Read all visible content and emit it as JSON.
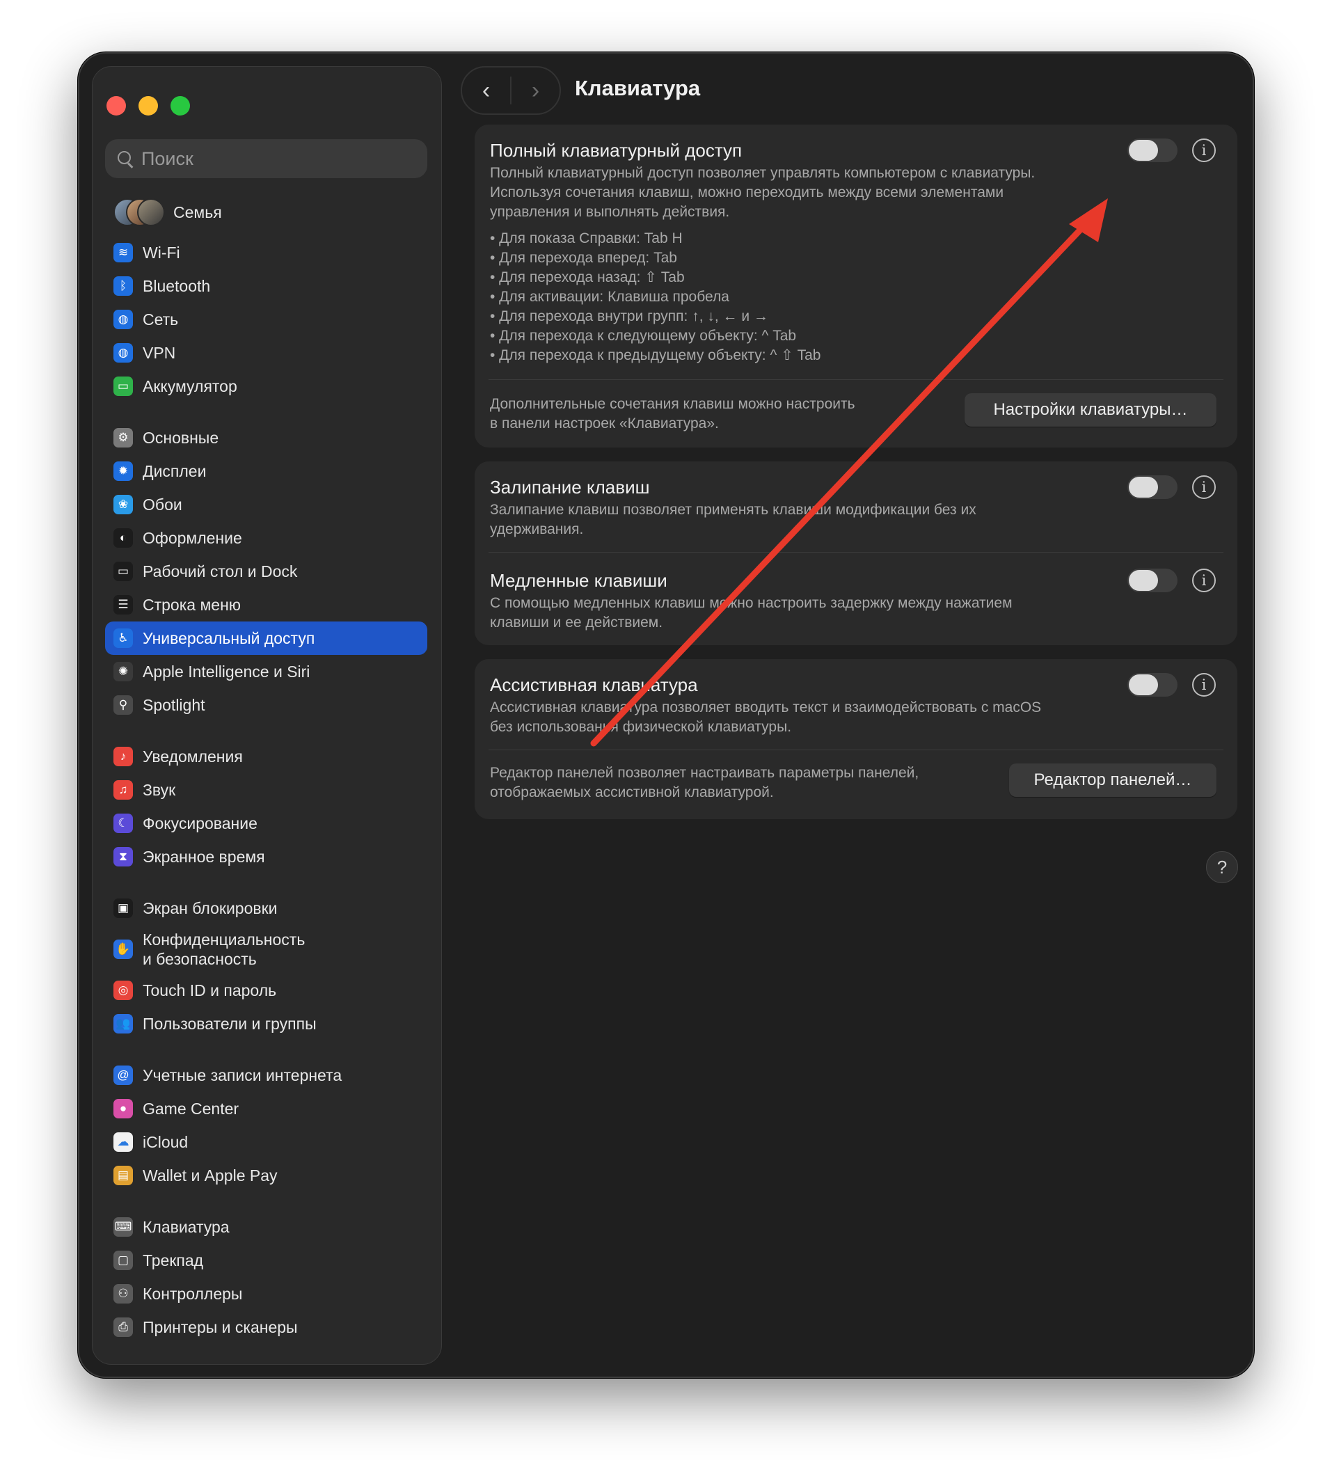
{
  "window": {
    "title": "Клавиатура",
    "back_glyph": "‹",
    "forward_glyph": "›"
  },
  "sidebar": {
    "search_placeholder": "Поиск",
    "family_label": "Семья",
    "items": [
      {
        "label": "Wi-Fi",
        "icon": "wifi-icon",
        "glyph": "≋",
        "color": "#1f6fe0"
      },
      {
        "label": "Bluetooth",
        "icon": "bluetooth-icon",
        "glyph": "ᛒ",
        "color": "#1f6fe0"
      },
      {
        "label": "Сеть",
        "icon": "globe-icon",
        "glyph": "◍",
        "color": "#1f6fe0"
      },
      {
        "label": "VPN",
        "icon": "vpn-globe-icon",
        "glyph": "◍",
        "color": "#1f6fe0"
      },
      {
        "label": "Аккумулятор",
        "icon": "battery-icon",
        "glyph": "▭",
        "color": "#2fb24a"
      },
      {
        "label": "Основные",
        "icon": "gear-icon",
        "glyph": "⚙",
        "color": "#7a7a7a"
      },
      {
        "label": "Дисплеи",
        "icon": "sun-icon",
        "glyph": "✹",
        "color": "#1f6fe0"
      },
      {
        "label": "Обои",
        "icon": "wallpaper-flower-icon",
        "glyph": "❀",
        "color": "#2a9be8"
      },
      {
        "label": "Оформление",
        "icon": "appearance-icon",
        "glyph": "◐",
        "color": "#1c1c1c"
      },
      {
        "label": "Рабочий стол и Dock",
        "icon": "dock-icon",
        "glyph": "▭",
        "color": "#1c1c1c"
      },
      {
        "label": "Строка меню",
        "icon": "menubar-icon",
        "glyph": "☰",
        "color": "#1c1c1c"
      },
      {
        "label": "Универсальный доступ",
        "icon": "accessibility-icon",
        "glyph": "♿",
        "color": "#1f6fe0"
      },
      {
        "label": "Apple Intelligence и Siri",
        "icon": "siri-icon",
        "glyph": "✺",
        "color": "#3a3a3a"
      },
      {
        "label": "Spotlight",
        "icon": "spotlight-search-icon",
        "glyph": "⚲",
        "color": "#4a4a4a"
      },
      {
        "label": "Уведомления",
        "icon": "bell-icon",
        "glyph": "♪",
        "color": "#e8453c"
      },
      {
        "label": "Звук",
        "icon": "speaker-icon",
        "glyph": "♫",
        "color": "#e8453c"
      },
      {
        "label": "Фокусирование",
        "icon": "moon-icon",
        "glyph": "☾",
        "color": "#5b4bd8"
      },
      {
        "label": "Экранное время",
        "icon": "hourglass-icon",
        "glyph": "⧗",
        "color": "#5b4bd8"
      },
      {
        "label": "Экран блокировки",
        "icon": "lock-icon",
        "glyph": "▣",
        "color": "#1c1c1c"
      },
      {
        "label": "Конфиденциальность\nи безопасность",
        "icon": "hand-icon",
        "glyph": "✋",
        "color": "#2a6fe0"
      },
      {
        "label": "Touch ID и пароль",
        "icon": "fingerprint-icon",
        "glyph": "◎",
        "color": "#e8453c"
      },
      {
        "label": "Пользователи и группы",
        "icon": "users-icon",
        "glyph": "👥",
        "color": "#2a6fe0"
      },
      {
        "label": "Учетные записи интернета",
        "icon": "at-icon",
        "glyph": "@",
        "color": "#2a6fe0"
      },
      {
        "label": "Game Center",
        "icon": "game-center-icon",
        "glyph": "●",
        "color": "#d94fa8"
      },
      {
        "label": "iCloud",
        "icon": "cloud-icon",
        "glyph": "☁",
        "color": "#f2f2f2"
      },
      {
        "label": "Wallet и Apple Pay",
        "icon": "wallet-icon",
        "glyph": "▤",
        "color": "#e0a030"
      },
      {
        "label": "Клавиатура",
        "icon": "keyboard-icon",
        "glyph": "⌨",
        "color": "#5a5a5a"
      },
      {
        "label": "Трекпад",
        "icon": "trackpad-icon",
        "glyph": "▢",
        "color": "#5a5a5a"
      },
      {
        "label": "Контроллеры",
        "icon": "gamepad-icon",
        "glyph": "⚇",
        "color": "#5a5a5a"
      },
      {
        "label": "Принтеры и сканеры",
        "icon": "printer-icon",
        "glyph": "⎙",
        "color": "#5a5a5a"
      }
    ],
    "selected_index": 11
  },
  "full_keyboard_access": {
    "title": "Полный клавиатурный доступ",
    "description_lines": [
      "Полный клавиатурный доступ позволяет управлять компьютером с клавиатуры.",
      "Используя сочетания клавиш, можно переходить между всеми элементами",
      "управления и выполнять действия."
    ],
    "bullets": [
      "• Для показа Справки: Tab H",
      "• Для перехода вперед: Tab",
      "• Для перехода назад: ⇧ Tab",
      "• Для активации: Клавиша пробела",
      "• Для перехода внутри групп: ↑, ↓, ← и →",
      "• Для перехода к следующему объекту: ^ Tab",
      "• Для перехода к предыдущему объекту: ^ ⇧ Tab"
    ],
    "extra_lines": [
      "Дополнительные сочетания клавиш можно настроить",
      "в панели настроек «Клавиатура»."
    ],
    "button": "Настройки клавиатуры…",
    "enabled": false
  },
  "sticky_keys": {
    "title": "Залипание клавиш",
    "description_lines": [
      "Залипание клавиш позволяет применять клавиши модификации без их",
      "удерживания."
    ],
    "enabled": false
  },
  "slow_keys": {
    "title": "Медленные клавиши",
    "description_lines": [
      "С помощью медленных клавиш можно настроить задержку между нажатием",
      "клавиши и ее действием."
    ],
    "enabled": false
  },
  "assistive_keyboard": {
    "title": "Ассистивная клавиатура",
    "description_lines": [
      "Ассистивная клавиатура позволяет вводить текст и взаимодействовать с macOS",
      "без использования физической клавиатуры."
    ],
    "editor_lines": [
      "Редактор панелей позволяет настраивать параметры панелей,",
      "отображаемых ассистивной клавиатурой."
    ],
    "button": "Редактор панелей…",
    "enabled": false
  },
  "info_glyph": "i",
  "help_glyph": "?",
  "annotation_color": "#e8392a"
}
